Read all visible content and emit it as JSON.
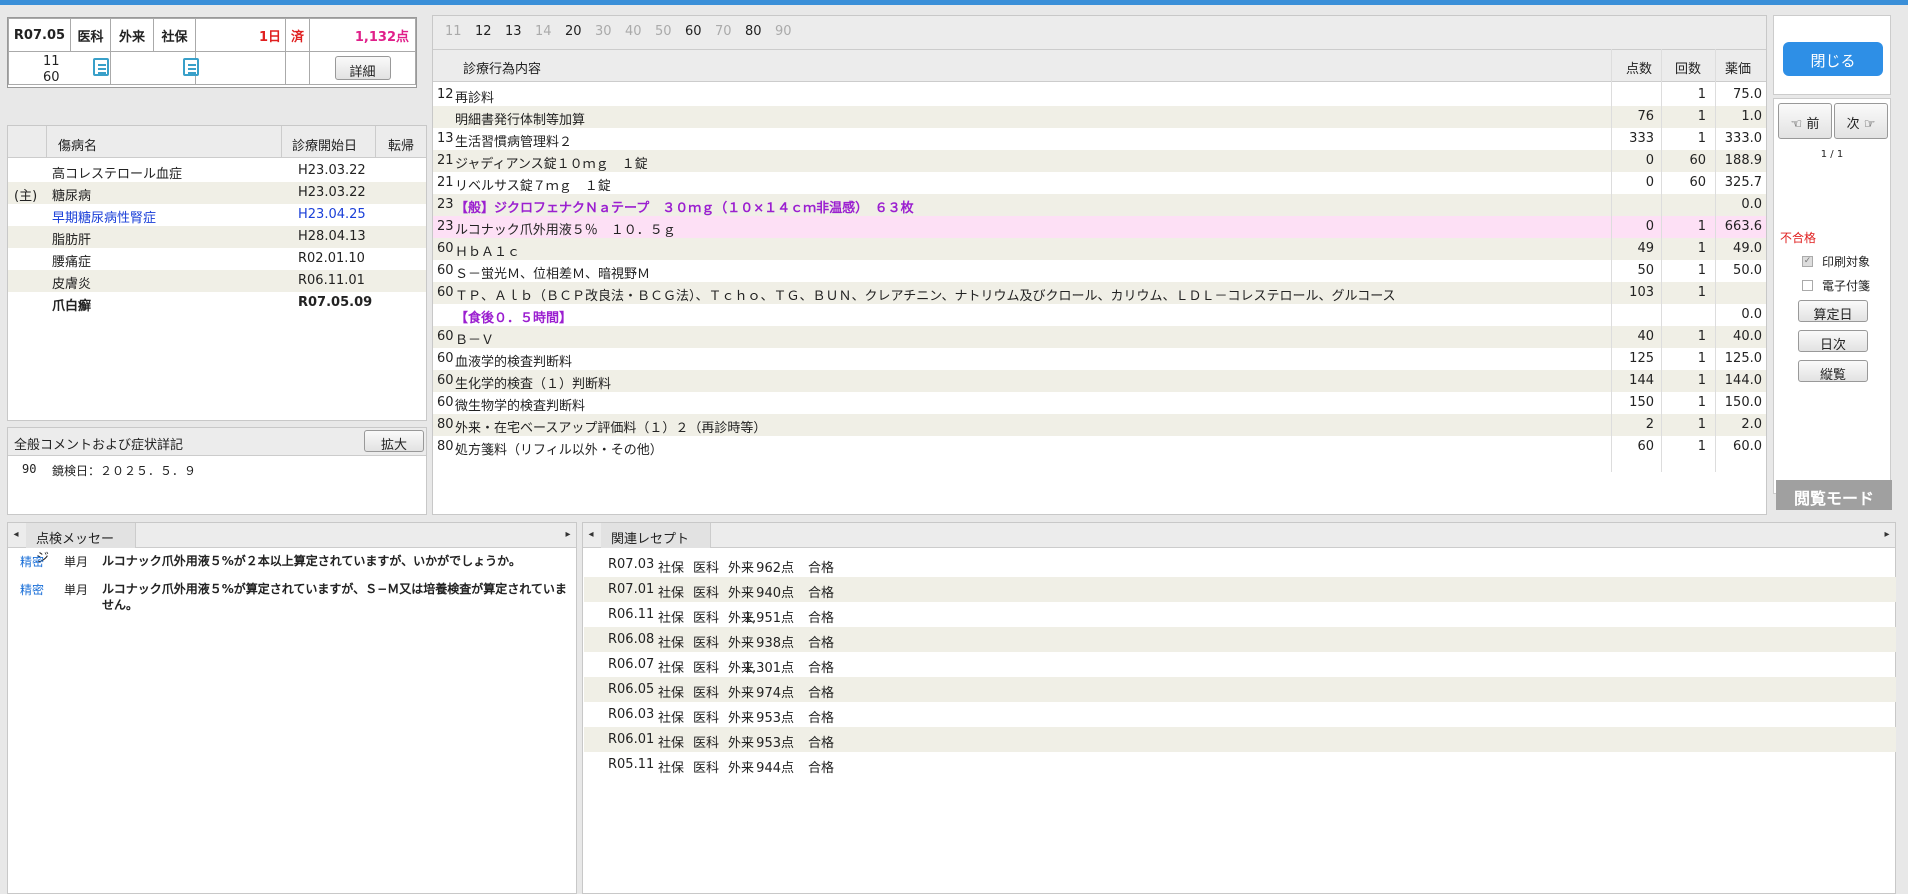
{
  "header": {
    "date": "R07.05",
    "dept": "医科",
    "visit": "外来",
    "insurance": "社保",
    "days": "1日",
    "status": "済",
    "points": "1,132点",
    "code1": "11",
    "code2": "60",
    "detail_label": "詳細"
  },
  "diseases": {
    "col_name": "傷病名",
    "col_start": "診療開始日",
    "col_outcome": "転帰",
    "rows": [
      {
        "mark": "",
        "name": "高コレステロール血症",
        "date": "H23.03.22",
        "style": "normal"
      },
      {
        "mark": "(主)",
        "name": "糖尿病",
        "date": "H23.03.22",
        "style": "normal"
      },
      {
        "mark": "",
        "name": "早期糖尿病性腎症",
        "date": "H23.04.25",
        "style": "blue"
      },
      {
        "mark": "",
        "name": "脂肪肝",
        "date": "H28.04.13",
        "style": "normal"
      },
      {
        "mark": "",
        "name": "腰痛症",
        "date": "R02.01.10",
        "style": "normal"
      },
      {
        "mark": "",
        "name": "皮膚炎",
        "date": "R06.11.01",
        "style": "normal"
      },
      {
        "mark": "",
        "name": "爪白癬",
        "date": "R07.05.09",
        "style": "bold"
      }
    ]
  },
  "comment": {
    "title": "全般コメントおよび症状詳記",
    "expand_label": "拡大",
    "code": "90",
    "text": "鏡検日：２０２５．５．９"
  },
  "items": {
    "nav": [
      "11",
      "12",
      "13",
      "14",
      "20",
      "30",
      "40",
      "50",
      "60",
      "70",
      "80",
      "90"
    ],
    "nav_active": [
      false,
      true,
      true,
      false,
      true,
      false,
      false,
      false,
      true,
      false,
      true,
      false
    ],
    "col_content": "診療行為内容",
    "col_points": "点数",
    "col_count": "回数",
    "col_price": "薬価",
    "rows": [
      {
        "code": "12",
        "text": "再診料",
        "pts": "",
        "cnt": "1",
        "price": "75.0",
        "style": "normal"
      },
      {
        "code": "",
        "text": "明細書発行体制等加算",
        "pts": "76",
        "cnt": "1",
        "price": "1.0",
        "style": "normal"
      },
      {
        "code": "13",
        "text": "生活習慣病管理料２",
        "pts": "333",
        "cnt": "1",
        "price": "333.0",
        "style": "normal"
      },
      {
        "code": "21",
        "text": "ジャディアンス錠１０ｍｇ　１錠",
        "pts": "0",
        "cnt": "60",
        "price": "188.9",
        "style": "normal"
      },
      {
        "code": "21",
        "text": "リベルサス錠７ｍｇ　１錠",
        "pts": "0",
        "cnt": "60",
        "price": "325.7",
        "style": "normal"
      },
      {
        "code": "23",
        "text": "【般】ジクロフェナクＮａテープ　３０ｍｇ（１０×１４ｃｍ非温感）　６３枚",
        "pts": "",
        "cnt": "",
        "price": "0.0",
        "style": "purple"
      },
      {
        "code": "23",
        "text": "ルコナック爪外用液５％　１０．５ｇ",
        "pts": "0",
        "cnt": "1",
        "price": "663.6",
        "style": "pink"
      },
      {
        "code": "60",
        "text": "ＨｂＡ１ｃ",
        "pts": "49",
        "cnt": "1",
        "price": "49.0",
        "style": "normal"
      },
      {
        "code": "60",
        "text": "Ｓ－蛍光Ｍ、位相差Ｍ、暗視野Ｍ",
        "pts": "50",
        "cnt": "1",
        "price": "50.0",
        "style": "normal"
      },
      {
        "code": "60",
        "text": "ＴＰ、Ａｌｂ（ＢＣＰ改良法・ＢＣＧ法）、Ｔｃｈｏ、ＴＧ、ＢＵＮ、クレアチニン、ナトリウム及びクロール、カリウム、ＬＤＬ－コレステロール、グルコース",
        "pts": "103",
        "cnt": "1",
        "price": "",
        "style": "normal"
      },
      {
        "code": "",
        "text": "【食後０．５時間】",
        "pts": "",
        "cnt": "",
        "price": "0.0",
        "style": "purple"
      },
      {
        "code": "60",
        "text": "Ｂ－Ｖ",
        "pts": "40",
        "cnt": "1",
        "price": "40.0",
        "style": "normal"
      },
      {
        "code": "60",
        "text": "血液学的検査判断料",
        "pts": "125",
        "cnt": "1",
        "price": "125.0",
        "style": "normal"
      },
      {
        "code": "60",
        "text": "生化学的検査（１）判断料",
        "pts": "144",
        "cnt": "1",
        "price": "144.0",
        "style": "normal"
      },
      {
        "code": "60",
        "text": "微生物学的検査判断料",
        "pts": "150",
        "cnt": "1",
        "price": "150.0",
        "style": "normal"
      },
      {
        "code": "80",
        "text": "外来・在宅ベースアップ評価料（１）２（再診時等）",
        "pts": "2",
        "cnt": "1",
        "price": "2.0",
        "style": "normal"
      },
      {
        "code": "80",
        "text": "処方箋料（リフィル以外・その他）",
        "pts": "60",
        "cnt": "1",
        "price": "60.0",
        "style": "normal"
      }
    ]
  },
  "side": {
    "close_label": "閉じる",
    "prev_label": "前",
    "next_label": "次",
    "page": "1 / 1",
    "fail_label": "不合格",
    "print_label": "印刷対象",
    "attach_label": "電子付箋",
    "calc_date_label": "算定日",
    "daily_label": "日次",
    "vertical_label": "縦覧",
    "mode_label": "閲覧モード"
  },
  "messages": {
    "tab_label": "点検メッセージ",
    "rows": [
      {
        "level": "精密",
        "scope": "単月",
        "text": "ルコナック爪外用液５%が２本以上算定されていますが、いかがでしょうか。"
      },
      {
        "level": "精密",
        "scope": "単月",
        "text": "ルコナック爪外用液５%が算定されていますが、Ｓ−Ｍ又は培養検査が算定されていません。"
      }
    ]
  },
  "related": {
    "tab_label": "関連レセプト",
    "rows": [
      {
        "date": "R07.03",
        "ins": "社保",
        "dept": "医科",
        "visit": "外来",
        "pts": "962点",
        "result": "合格"
      },
      {
        "date": "R07.01",
        "ins": "社保",
        "dept": "医科",
        "visit": "外来",
        "pts": "940点",
        "result": "合格"
      },
      {
        "date": "R06.11",
        "ins": "社保",
        "dept": "医科",
        "visit": "外来",
        "pts": "1,951点",
        "result": "合格"
      },
      {
        "date": "R06.08",
        "ins": "社保",
        "dept": "医科",
        "visit": "外来",
        "pts": "938点",
        "result": "合格"
      },
      {
        "date": "R06.07",
        "ins": "社保",
        "dept": "医科",
        "visit": "外来",
        "pts": "1,301点",
        "result": "合格"
      },
      {
        "date": "R06.05",
        "ins": "社保",
        "dept": "医科",
        "visit": "外来",
        "pts": "974点",
        "result": "合格"
      },
      {
        "date": "R06.03",
        "ins": "社保",
        "dept": "医科",
        "visit": "外来",
        "pts": "953点",
        "result": "合格"
      },
      {
        "date": "R06.01",
        "ins": "社保",
        "dept": "医科",
        "visit": "外来",
        "pts": "953点",
        "result": "合格"
      },
      {
        "date": "R05.11",
        "ins": "社保",
        "dept": "医科",
        "visit": "外来",
        "pts": "944点",
        "result": "合格"
      }
    ]
  },
  "colors": {
    "accent": "#2e8fe6",
    "pink_row": "#fde0f5",
    "purple_text": "#9b1fd0",
    "blue_text": "#1a3fd8",
    "fail": "#e02020"
  }
}
